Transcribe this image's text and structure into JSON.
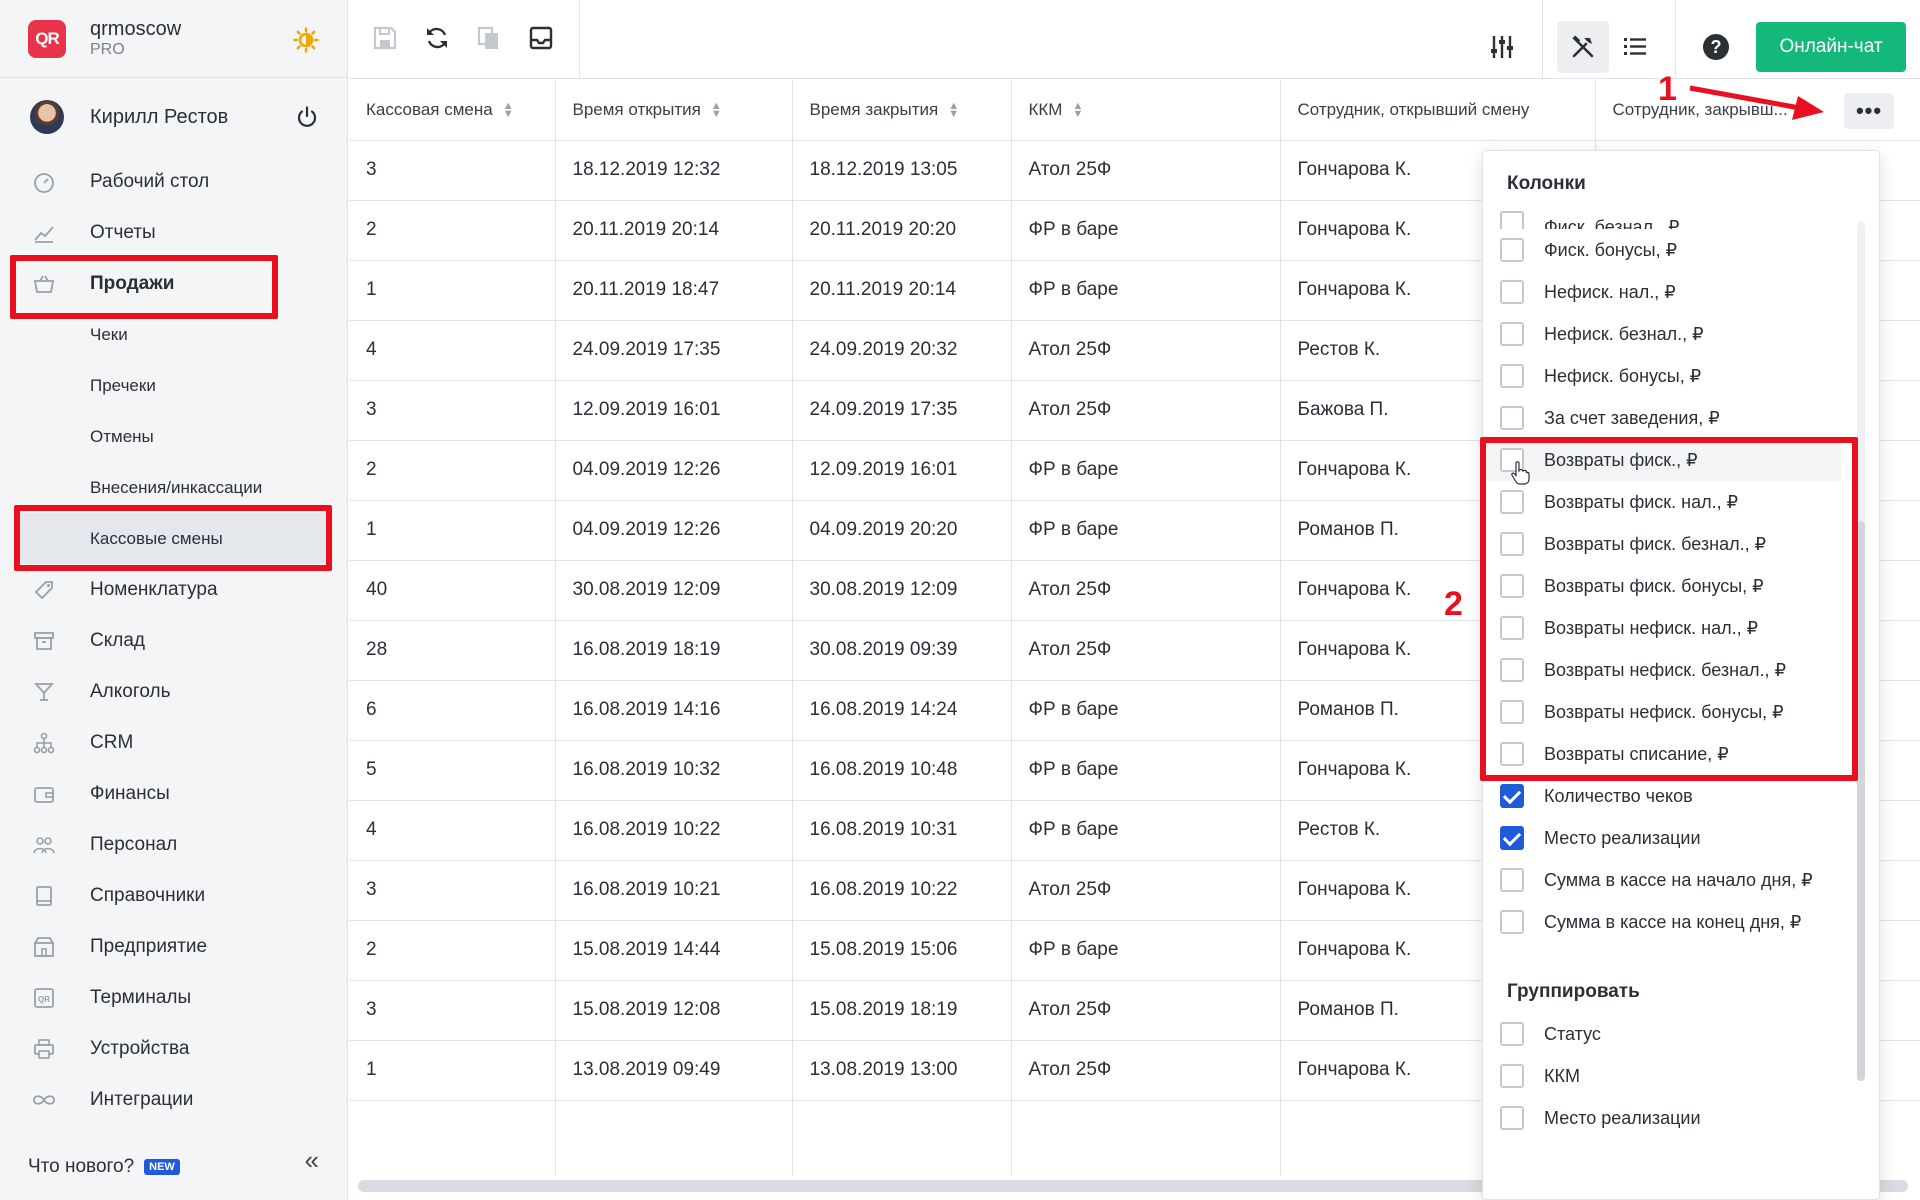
{
  "brand": {
    "logo": "QR",
    "name": "qrmoscow",
    "plan": "PRO"
  },
  "user": {
    "name": "Кирилл Рестов"
  },
  "nav": [
    {
      "label": "Рабочий стол",
      "icon": "dashboard-icon"
    },
    {
      "label": "Отчеты",
      "icon": "reports-icon"
    },
    {
      "label": "Продажи",
      "icon": "basket-icon"
    }
  ],
  "sales_sub": [
    "Чеки",
    "Пречеки",
    "Отмены",
    "Внесения/инкассации",
    "Кассовые смены"
  ],
  "nav2": [
    {
      "label": "Номенклатура",
      "icon": "tag-icon"
    },
    {
      "label": "Склад",
      "icon": "warehouse-icon"
    },
    {
      "label": "Алкоголь",
      "icon": "glass-icon"
    },
    {
      "label": "CRM",
      "icon": "crm-icon"
    },
    {
      "label": "Финансы",
      "icon": "wallet-icon"
    },
    {
      "label": "Персонал",
      "icon": "staff-icon"
    },
    {
      "label": "Справочники",
      "icon": "book-icon"
    },
    {
      "label": "Предприятие",
      "icon": "enterprise-icon"
    },
    {
      "label": "Терминалы",
      "icon": "terminal-icon"
    },
    {
      "label": "Устройства",
      "icon": "printer-icon"
    },
    {
      "label": "Интеграции",
      "icon": "infinity-icon"
    }
  ],
  "footer": {
    "whats_new": "Что нового?",
    "badge": "NEW"
  },
  "toolbar": {
    "chat": "Онлайн-чат"
  },
  "table": {
    "columns": [
      "Кассовая смена",
      "Время открытия",
      "Время закрытия",
      "ККМ",
      "Сотрудник, открывший смену",
      "Сотрудник, закрывш..."
    ],
    "rows": [
      [
        "3",
        "18.12.2019 12:32",
        "18.12.2019 13:05",
        "Атол 25Ф",
        "Гончарова К."
      ],
      [
        "2",
        "20.11.2019 20:14",
        "20.11.2019 20:20",
        "ФР в баре",
        "Гончарова К."
      ],
      [
        "1",
        "20.11.2019 18:47",
        "20.11.2019 20:14",
        "ФР в баре",
        "Гончарова К."
      ],
      [
        "4",
        "24.09.2019 17:35",
        "24.09.2019 20:32",
        "Атол 25Ф",
        "Рестов К."
      ],
      [
        "3",
        "12.09.2019 16:01",
        "24.09.2019 17:35",
        "Атол 25Ф",
        "Бажова П."
      ],
      [
        "2",
        "04.09.2019 12:26",
        "12.09.2019 16:01",
        "ФР в баре",
        "Гончарова К."
      ],
      [
        "1",
        "04.09.2019 12:26",
        "04.09.2019 20:20",
        "ФР в баре",
        "Романов П."
      ],
      [
        "40",
        "30.08.2019 12:09",
        "30.08.2019 12:09",
        "Атол 25Ф",
        "Гончарова К."
      ],
      [
        "28",
        "16.08.2019 18:19",
        "30.08.2019 09:39",
        "Атол 25Ф",
        "Гончарова К."
      ],
      [
        "6",
        "16.08.2019 14:16",
        "16.08.2019 14:24",
        "ФР в баре",
        "Романов П."
      ],
      [
        "5",
        "16.08.2019 10:32",
        "16.08.2019 10:48",
        "ФР в баре",
        "Гончарова К."
      ],
      [
        "4",
        "16.08.2019 10:22",
        "16.08.2019 10:31",
        "ФР в баре",
        "Рестов К."
      ],
      [
        "3",
        "16.08.2019 10:21",
        "16.08.2019 10:22",
        "Атол 25Ф",
        "Гончарова К."
      ],
      [
        "2",
        "15.08.2019 14:44",
        "15.08.2019 15:06",
        "ФР в баре",
        "Гончарова К."
      ],
      [
        "3",
        "15.08.2019 12:08",
        "15.08.2019 18:19",
        "Атол 25Ф",
        "Романов П."
      ],
      [
        "1",
        "13.08.2019 09:49",
        "13.08.2019 13:00",
        "Атол 25Ф",
        "Гончарова К."
      ]
    ]
  },
  "dropdown": {
    "title": "Колонки",
    "cut_item": "Фиск. безнал., ₽",
    "columns": [
      {
        "label": "Фиск. бонусы, ₽",
        "checked": false
      },
      {
        "label": "Нефиск. нал., ₽",
        "checked": false
      },
      {
        "label": "Нефиск. безнал., ₽",
        "checked": false
      },
      {
        "label": "Нефиск. бонусы, ₽",
        "checked": false
      },
      {
        "label": "За счет заведения, ₽",
        "checked": false
      },
      {
        "label": "Возвраты фиск., ₽",
        "checked": false
      },
      {
        "label": "Возвраты фиск. нал., ₽",
        "checked": false
      },
      {
        "label": "Возвраты фиск. безнал., ₽",
        "checked": false
      },
      {
        "label": "Возвраты фиск. бонусы, ₽",
        "checked": false
      },
      {
        "label": "Возвраты нефиск. нал., ₽",
        "checked": false
      },
      {
        "label": "Возвраты нефиск. безнал., ₽",
        "checked": false
      },
      {
        "label": "Возвраты нефиск. бонусы, ₽",
        "checked": false
      },
      {
        "label": "Возвраты списание, ₽",
        "checked": false
      },
      {
        "label": "Количество чеков",
        "checked": true
      },
      {
        "label": "Место реализации",
        "checked": true
      },
      {
        "label": "Сумма в кассе на начало дня, ₽",
        "checked": false
      },
      {
        "label": "Сумма в кассе на конец дня, ₽",
        "checked": false
      }
    ],
    "group_title": "Группировать",
    "group": [
      {
        "label": "Статус",
        "checked": false
      },
      {
        "label": "ККМ",
        "checked": false
      },
      {
        "label": "Место реализации",
        "checked": false
      }
    ]
  },
  "annotations": {
    "marker1": "1",
    "marker2": "2"
  },
  "colors": {
    "accent": "#1f5ad8",
    "chat": "#14b87a",
    "highlight": "#e8101f",
    "logo": "#e8334a"
  }
}
